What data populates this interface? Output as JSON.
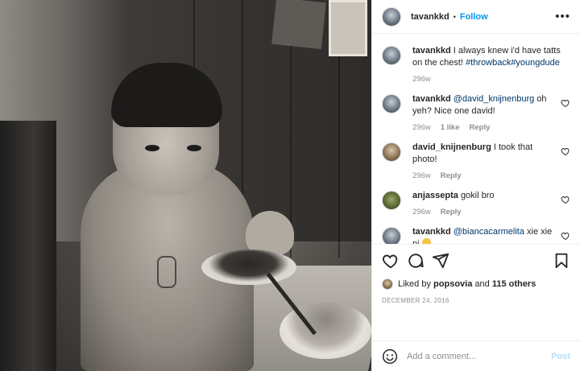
{
  "post": {
    "username": "tavankkd",
    "follow_label": "Follow",
    "separator": "•",
    "more_icon": "more-horizontal-icon"
  },
  "caption": {
    "username": "tavankkd",
    "text": "I always knew i'd have tatts on the chest!",
    "hashtags": "#throwback#youngdude",
    "time": "296w"
  },
  "comments": [
    {
      "username": "tavankkd",
      "mention": "@david_knijnenburg",
      "text": "oh yeh? Nice one david!",
      "time": "296w",
      "likes": "1 like",
      "reply": "Reply"
    },
    {
      "username": "david_knijnenburg",
      "mention": "",
      "text": "I took that photo!",
      "time": "296w",
      "likes": "",
      "reply": "Reply"
    },
    {
      "username": "anjassepta",
      "mention": "",
      "text": "gokil bro",
      "time": "296w",
      "likes": "",
      "reply": "Reply"
    },
    {
      "username": "tavankkd",
      "mention": "@biancacarmelita",
      "text": "xie xie ni",
      "time": "",
      "likes": "",
      "reply": ""
    }
  ],
  "actions": {
    "icons": [
      "heart-icon",
      "comment-icon",
      "share-icon",
      "bookmark-icon"
    ],
    "liked_by_prefix": "Liked by",
    "liked_by_user": "popsovia",
    "liked_by_and": "and",
    "liked_by_others": "115 others",
    "date": "DECEMBER 24, 2016"
  },
  "add_comment": {
    "placeholder": "Add a comment...",
    "post_label": "Post"
  },
  "colors": {
    "accent": "#0095f6",
    "post_disabled": "#b2dffc",
    "mention": "#00376b",
    "muted": "#8e8e8e"
  }
}
